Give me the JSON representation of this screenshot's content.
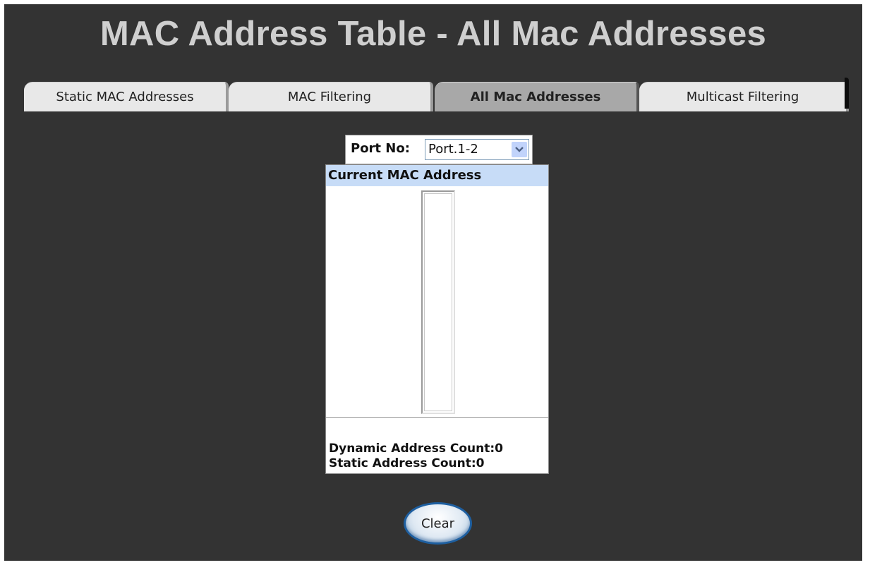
{
  "page": {
    "title": "MAC Address Table - All Mac Addresses"
  },
  "tabs": [
    {
      "label": "Static MAC Addresses",
      "active": false
    },
    {
      "label": "MAC Filtering",
      "active": false
    },
    {
      "label": "All Mac Addresses",
      "active": true
    },
    {
      "label": "Multicast Filtering",
      "active": false
    }
  ],
  "port": {
    "label": "Port No:",
    "selected": "Port.1-2"
  },
  "mac_table": {
    "header": "Current MAC Address",
    "entries": [],
    "dynamic_count_label": "Dynamic Address Count:",
    "dynamic_count": "0",
    "static_count_label": "Static Address Count:",
    "static_count": "0"
  },
  "actions": {
    "clear_label": "Clear"
  },
  "icons": {
    "dropdown": "chevron-down-icon"
  },
  "colors": {
    "background": "#333333",
    "title_text": "#cfcfcf",
    "tab_inactive": "#e8e8e8",
    "tab_active": "#a8a8a8",
    "table_header": "#c7dcf7",
    "button_border": "#1e5fa0"
  }
}
